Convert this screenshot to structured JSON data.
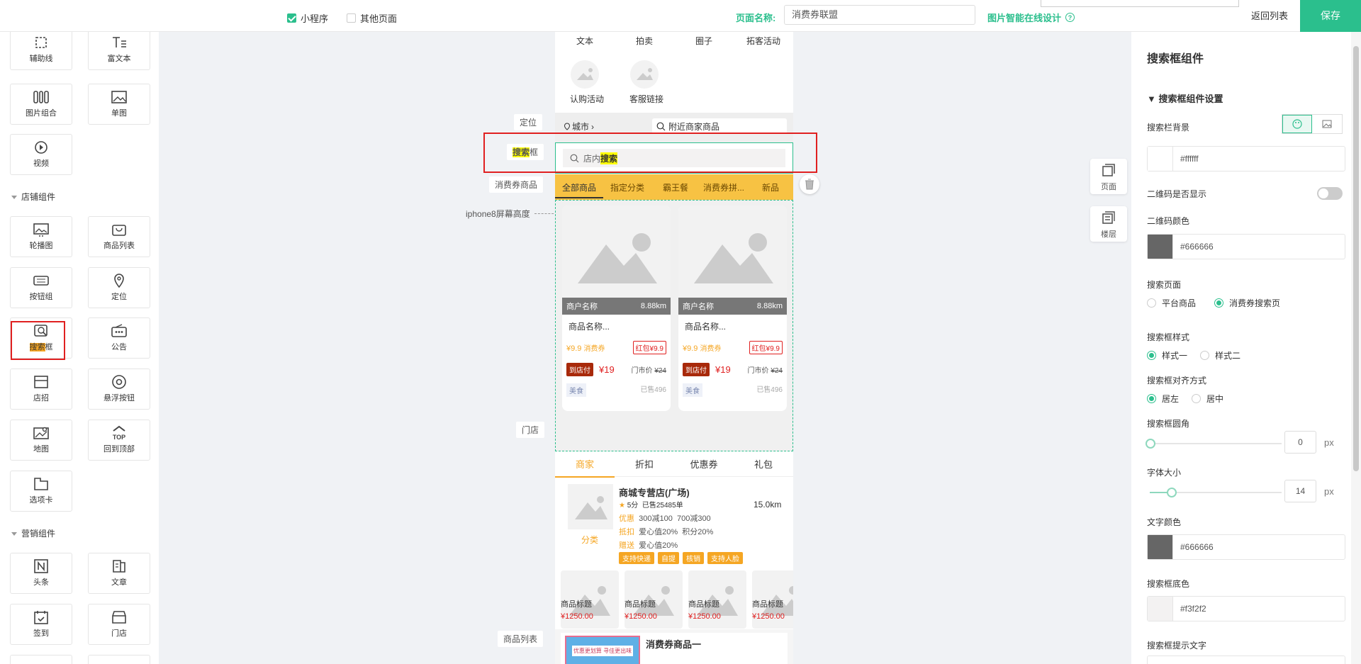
{
  "topbar": {
    "miniprogram": "小程序",
    "other_pages": "其他页面",
    "page_name_label": "页面名称:",
    "page_name_value": "消费券联盟",
    "design_link": "图片智能在线设计",
    "back": "返回列表",
    "save": "保存"
  },
  "left": {
    "basic_items": [
      "辅助线",
      "富文本",
      "图片组合",
      "单图",
      "视频"
    ],
    "shop_section": "店铺组件",
    "shop_items": [
      "轮播图",
      "商品列表",
      "按钮组",
      "定位",
      "搜索框",
      "公告",
      "店招",
      "悬浮按钮",
      "地图",
      "回到顶部",
      "选项卡"
    ],
    "search_hl": "搜索",
    "search_rest": "框",
    "marketing_section": "营销组件",
    "marketing_items": [
      "头条",
      "文章",
      "签到",
      "门店"
    ],
    "top_text": "TOP"
  },
  "canvas": {
    "labels": [
      "定位",
      "消费券商品",
      "iphone8屏幕高度",
      "门店",
      "商品列表"
    ],
    "search_label_hl": "搜索",
    "search_label_rest": "框",
    "float_page": "页面",
    "float_layer": "楼层",
    "nav_top": [
      "文本",
      "拍卖",
      "圈子",
      "拓客活动"
    ],
    "nav_second": [
      "认购活动",
      "客服链接"
    ],
    "city": "城市",
    "nearby": "附近商家商品",
    "search_placeholder_a": "店内",
    "search_placeholder_b": "搜索",
    "tabs": [
      "全部商品",
      "指定分类",
      "霸王餐",
      "消费券拼...",
      "新品"
    ],
    "merchant": "商户名称",
    "distance": "8.88km",
    "product_name": "商品名称...",
    "coupon_price": "¥9.9",
    "coupon_text": "消费券",
    "hongbao": "红包¥9.9",
    "pay_store": "到店付",
    "price": "¥19",
    "market_price_label": "门市价",
    "market_price": "¥24",
    "category": "美食",
    "sold": "已售496",
    "store_tabs": [
      "商家",
      "折扣",
      "优惠券",
      "礼包"
    ],
    "store_name": "商城专营店(广场)",
    "rating": "5分",
    "store_sold": "已售25485单",
    "store_dist": "15.0km",
    "youhui_label": "优惠",
    "youhui_a": "300减100",
    "youhui_b": "700减300",
    "dikou_label": "抵扣",
    "dikou_a": "爱心值20%",
    "dikou_b": "积分20%",
    "zengsong_label": "赠送",
    "zengsong_a": "爱心值20%",
    "category_link": "分类",
    "store_tags": [
      "支持快递",
      "自提",
      "核销",
      "支持人脸"
    ],
    "goods_title": "商品标题",
    "goods_price": "¥1250.00",
    "coupon_goods_title": "消费券商品一",
    "banner_text": "优惠更划算 寻佳更出味"
  },
  "right": {
    "title": "搜索框组件",
    "section": "搜索框组件设置",
    "bg_label": "搜索栏背景",
    "bg_value": "#ffffff",
    "qr_show_label": "二维码是否显示",
    "qr_color_label": "二维码颜色",
    "qr_color_value": "#666666",
    "search_page_label": "搜索页面",
    "search_page_options": [
      "平台商品",
      "消费券搜索页"
    ],
    "style_label": "搜索框样式",
    "style_options": [
      "样式一",
      "样式二"
    ],
    "align_label": "搜索框对齐方式",
    "align_options": [
      "居左",
      "居中"
    ],
    "radius_label": "搜索框圆角",
    "radius_value": "0",
    "font_size_label": "字体大小",
    "font_size_value": "14",
    "unit": "px",
    "text_color_label": "文字颜色",
    "text_color_value": "#666666",
    "base_color_label": "搜索框底色",
    "base_color_value": "#f3f2f2",
    "hint_label": "搜索框提示文字"
  },
  "colors": {
    "accent": "#2bbf8d",
    "tabbar": "#f7c243",
    "highlight": "#ffff00",
    "red": "#e02020"
  }
}
